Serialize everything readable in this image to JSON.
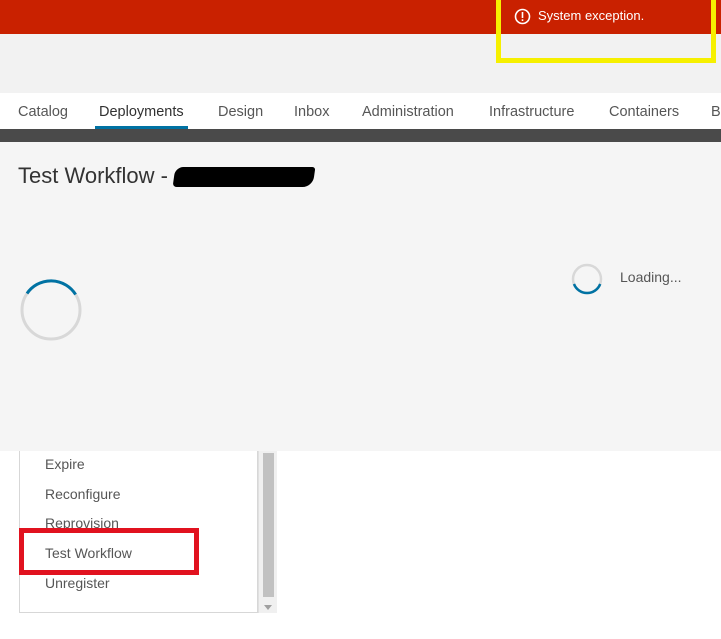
{
  "banner": {
    "message": "System exception.",
    "icon": "error-circle-icon",
    "color": "#c92100"
  },
  "nav": {
    "tabs": [
      {
        "label": "Catalog",
        "active": false
      },
      {
        "label": "Deployments",
        "active": true
      },
      {
        "label": "Design",
        "active": false
      },
      {
        "label": "Inbox",
        "active": false
      },
      {
        "label": "Administration",
        "active": false
      },
      {
        "label": "Infrastructure",
        "active": false
      },
      {
        "label": "Containers",
        "active": false
      },
      {
        "label": "B",
        "active": false
      }
    ],
    "accent_color": "#0072a3"
  },
  "page": {
    "title": "Test Workflow -",
    "loading_text": "Loading..."
  },
  "actions": {
    "items": [
      "Expire",
      "Reconfigure",
      "Reprovision",
      "Test Workflow",
      "Unregister"
    ]
  },
  "annotations": {
    "highlight_color_error": "#f6f000",
    "highlight_color_item": "#e1121f"
  }
}
